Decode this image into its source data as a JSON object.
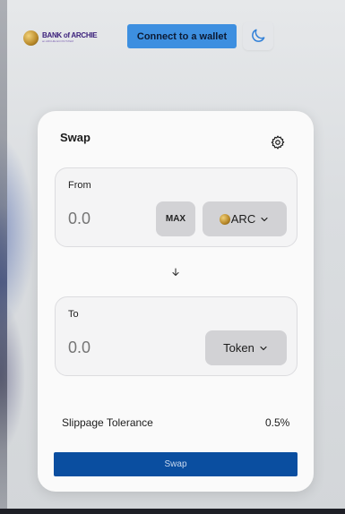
{
  "header": {
    "logo_title": "BANK of ARCHIE",
    "logo_subtitle": "an ARCHIE ECOSYSTEM",
    "connect_label": "Connect to a wallet",
    "theme_icon": "moon-icon"
  },
  "swap": {
    "title": "Swap",
    "settings_icon": "gear-icon",
    "from": {
      "label": "From",
      "amount_placeholder": "0.0",
      "max_label": "MAX",
      "token_label": "ARC",
      "token_icon": "arc-coin-icon"
    },
    "direction_icon": "arrow-down-icon",
    "to": {
      "label": "To",
      "amount_placeholder": "0.0",
      "token_label": "Token"
    },
    "slippage_label": "Slippage Tolerance",
    "slippage_value": "0.5%",
    "submit_label": "Swap"
  },
  "colors": {
    "connect_button": "#3d8fe0",
    "swap_button": "#0a4ea0",
    "card_background": "#fafafa",
    "panel_background": "#f4f4f5"
  }
}
